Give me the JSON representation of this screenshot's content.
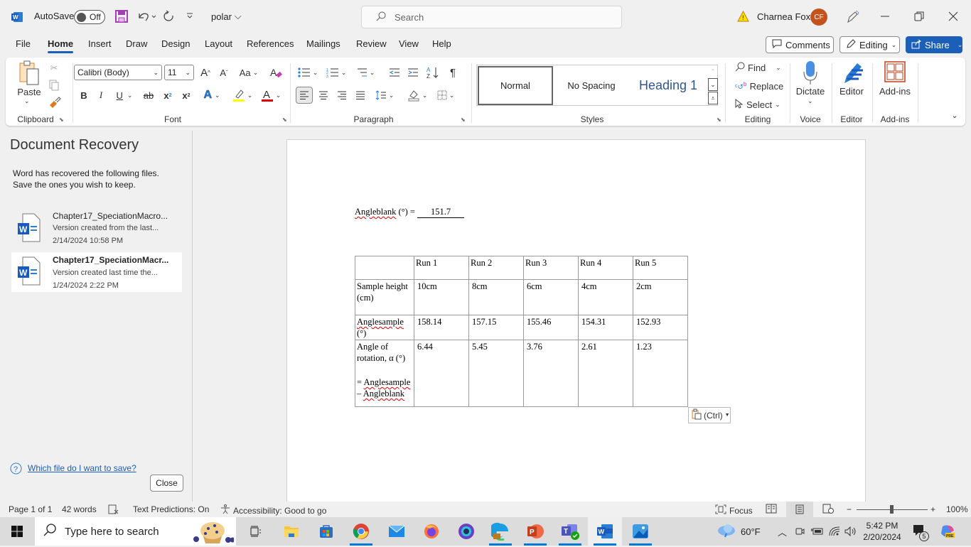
{
  "titlebar": {
    "autosave_label": "AutoSave",
    "autosave_state": "Off",
    "doc_name": "polar",
    "search_placeholder": "Search",
    "user_name": "Charnea Fox",
    "user_initials": "CF"
  },
  "tabs": [
    "File",
    "Home",
    "Insert",
    "Draw",
    "Design",
    "Layout",
    "References",
    "Mailings",
    "Review",
    "View",
    "Help"
  ],
  "active_tab": "Home",
  "header_buttons": {
    "comments": "Comments",
    "editing": "Editing",
    "share": "Share"
  },
  "ribbon": {
    "clipboard": {
      "paste": "Paste",
      "label": "Clipboard"
    },
    "font": {
      "name": "Calibri (Body)",
      "size": "11",
      "label": "Font",
      "change_case": "Aa"
    },
    "paragraph": {
      "label": "Paragraph"
    },
    "styles": {
      "items": [
        "Normal",
        "No Spacing",
        "Heading 1"
      ],
      "label": "Styles"
    },
    "editing": {
      "find": "Find",
      "replace": "Replace",
      "select": "Select",
      "label": "Editing"
    },
    "voice": {
      "dictate": "Dictate",
      "label": "Voice"
    },
    "editor": {
      "editor": "Editor",
      "label": "Editor"
    },
    "addins": {
      "addins": "Add-ins",
      "label": "Add-ins"
    },
    "colors": {
      "highlight": "#ffff00",
      "font_color": "#e00000"
    }
  },
  "recovery": {
    "title": "Document Recovery",
    "message_line1": "Word has recovered the following files.",
    "message_line2": "Save the ones you wish to keep.",
    "files": [
      {
        "name": "Chapter17_SpeciationMacro...",
        "desc": "Version created from the last...",
        "date": "2/14/2024 10:58 PM",
        "selected": false
      },
      {
        "name": "Chapter17_SpeciationMacr...",
        "desc": "Version created last time the...",
        "date": "1/24/2024 2:22 PM",
        "selected": true
      }
    ],
    "help_link": "Which file do I want to save?",
    "close": "Close"
  },
  "document": {
    "blank_label": "Angleblank",
    "blank_suffix": " (°) = ",
    "blank_value": "151.7",
    "table": {
      "header": [
        "",
        "Run 1",
        "Run 2",
        "Run 3",
        "Run 4",
        "Run 5"
      ],
      "rows": [
        {
          "label_a": "Sample height",
          "label_b": "(cm)",
          "values": [
            "10cm",
            "8cm",
            "6cm",
            "4cm",
            "2cm"
          ]
        },
        {
          "label_a": "Anglesample",
          "label_b": "(°)",
          "values": [
            "158.14",
            "157.15",
            "155.46",
            "154.31",
            "152.93"
          ]
        },
        {
          "label_a": "Angle of",
          "label_b": "rotation, α (°)",
          "label_c": "= Anglesample",
          "label_d": "– Angleblank",
          "values": [
            "6.44",
            "5.45",
            "3.76",
            "2.61",
            "1.23"
          ]
        }
      ]
    },
    "paste_options": "(Ctrl)"
  },
  "status": {
    "page": "Page 1 of 1",
    "words": "42 words",
    "predictions": "Text Predictions: On",
    "accessibility": "Accessibility: Good to go",
    "focus": "Focus",
    "zoom": "100%",
    "zoom_minus": "−",
    "zoom_plus": "+"
  },
  "taskbar": {
    "search_placeholder": "Type here to search",
    "weather": "60°F",
    "time": "5:42 PM",
    "date": "2/20/2024",
    "notifications": "5"
  }
}
